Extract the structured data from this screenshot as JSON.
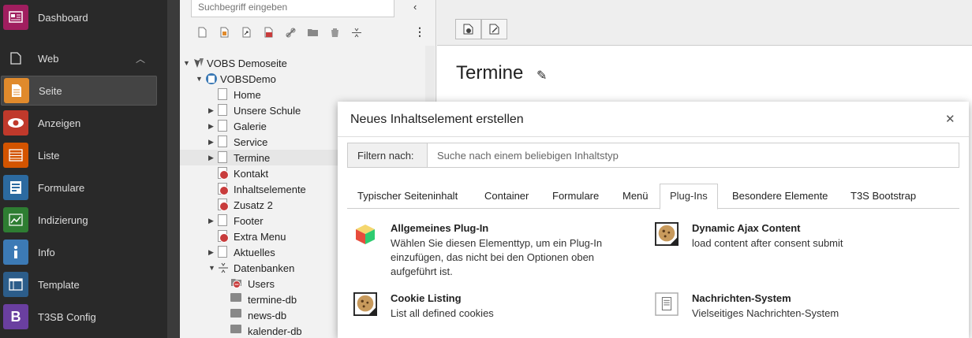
{
  "sidebar": {
    "items": [
      {
        "label": "Dashboard",
        "color": "#a01e5f",
        "icon": "dashboard-icon"
      },
      {
        "label": "Web",
        "color": "#292929",
        "icon": "web-page-icon"
      },
      {
        "label": "Seite",
        "color": "#e08a2c",
        "icon": "page-module-icon"
      },
      {
        "label": "Anzeigen",
        "color": "#c0392b",
        "icon": "eye-icon"
      },
      {
        "label": "Liste",
        "color": "#d35400",
        "icon": "list-icon"
      },
      {
        "label": "Formulare",
        "color": "#2c6aa0",
        "icon": "forms-icon"
      },
      {
        "label": "Indizierung",
        "color": "#2e7d32",
        "icon": "chart-icon"
      },
      {
        "label": "Info",
        "color": "#3c7ab5",
        "icon": "info-icon"
      },
      {
        "label": "Template",
        "color": "#2c5d8a",
        "icon": "template-icon"
      },
      {
        "label": "T3SB Config",
        "color": "#6a3fa0",
        "icon": "bootstrap-icon"
      }
    ]
  },
  "tree": {
    "search_placeholder": "Suchbegriff eingeben",
    "nodes": [
      {
        "label": "VOBS Demoseite"
      },
      {
        "label": "VOBSDemo"
      },
      {
        "label": "Home"
      },
      {
        "label": "Unsere Schule"
      },
      {
        "label": "Galerie"
      },
      {
        "label": "Service"
      },
      {
        "label": "Termine"
      },
      {
        "label": "Kontakt"
      },
      {
        "label": "Inhaltselemente"
      },
      {
        "label": "Zusatz 2"
      },
      {
        "label": "Footer"
      },
      {
        "label": "Extra Menu"
      },
      {
        "label": "Aktuelles"
      },
      {
        "label": "Datenbanken"
      },
      {
        "label": "Users"
      },
      {
        "label": "termine-db"
      },
      {
        "label": "news-db"
      },
      {
        "label": "kalender-db"
      }
    ]
  },
  "doc": {
    "title": "Termine"
  },
  "modal": {
    "title": "Neues Inhaltselement erstellen",
    "filter_label": "Filtern nach:",
    "filter_placeholder": "Suche nach einem beliebigen Inhaltstyp",
    "tabs": [
      "Typischer Seiteninhalt",
      "Container",
      "Formulare",
      "Menü",
      "Plug-Ins",
      "Besondere Elemente",
      "T3S Bootstrap"
    ],
    "active_tab": "Plug-Ins",
    "elements": [
      {
        "title": "Allgemeines Plug-In",
        "desc": "Wählen Sie diesen Elementtyp, um ein Plug-In einzufügen, das nicht bei den Optionen oben aufgeführt ist.",
        "icon": "plugin-cube-icon"
      },
      {
        "title": "Dynamic Ajax Content",
        "desc": "load content after consent submit",
        "icon": "cookie-icon"
      },
      {
        "title": "Cookie Listing",
        "desc": "List all defined cookies",
        "icon": "cookie-icon"
      },
      {
        "title": "Nachrichten-System",
        "desc": "Vielseitiges Nachrichten-System",
        "icon": "news-document-icon"
      }
    ]
  }
}
